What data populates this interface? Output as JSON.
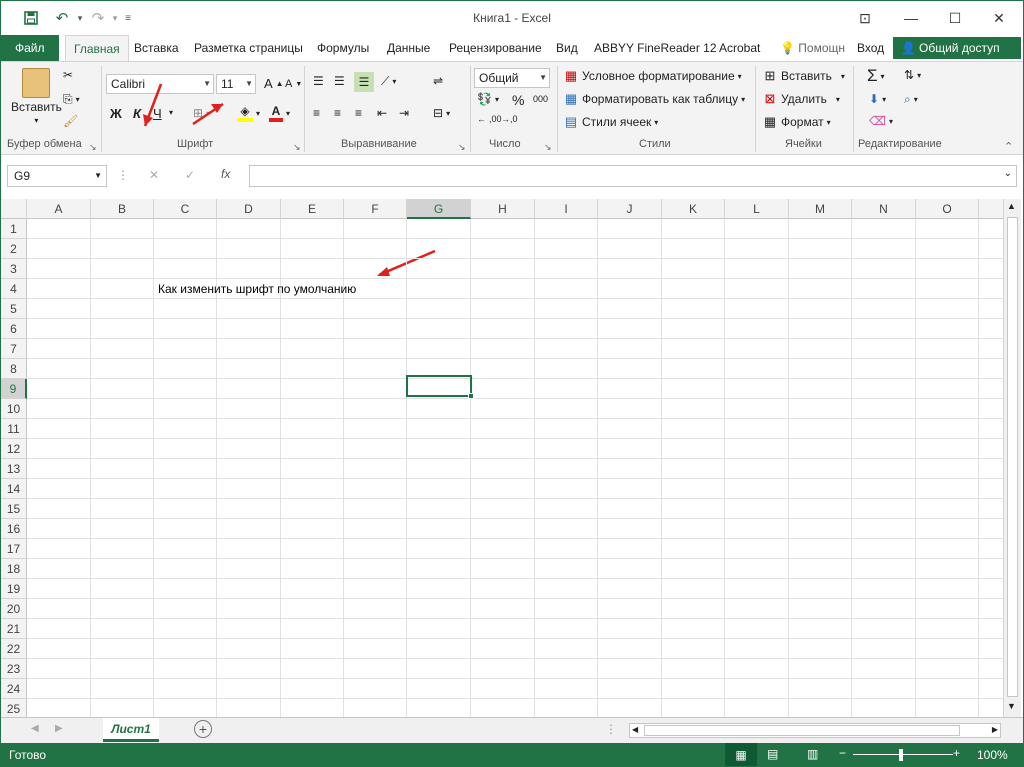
{
  "window": {
    "title": "Книга1 - Excel",
    "accent": "#217346"
  },
  "quick_access": {
    "save_icon": "save-icon",
    "undo_icon": "undo-icon",
    "redo_icon": "redo-icon"
  },
  "tabs": [
    {
      "label": "Файл"
    },
    {
      "label": "Главная"
    },
    {
      "label": "Вставка"
    },
    {
      "label": "Разметка страницы"
    },
    {
      "label": "Формулы"
    },
    {
      "label": "Данные"
    },
    {
      "label": "Рецензирование"
    },
    {
      "label": "Вид"
    },
    {
      "label": "ABBYY FineReader 12"
    },
    {
      "label": "Acrobat"
    }
  ],
  "tell_me": "Помощн",
  "sign_in": "Вход",
  "share": "Общий доступ",
  "ribbon": {
    "clipboard": {
      "paste": "Вставить",
      "label": "Буфер обмена"
    },
    "font": {
      "name": "Calibri",
      "size": "11",
      "bold": "Ж",
      "italic": "К",
      "underline": "Ч",
      "grow": "A",
      "shrink": "A",
      "label": "Шрифт"
    },
    "alignment": {
      "label": "Выравнивание"
    },
    "number": {
      "format": "Общий",
      "percent": "%",
      "thousands": "000",
      "inc_dec": ",00",
      "label": "Число"
    },
    "styles": {
      "conditional": "Условное форматирование",
      "as_table": "Форматировать как таблицу",
      "cell_styles": "Стили ячеек",
      "label": "Стили"
    },
    "cells": {
      "insert": "Вставить",
      "delete": "Удалить",
      "format": "Формат",
      "label": "Ячейки"
    },
    "editing": {
      "label": "Редактирование"
    }
  },
  "formula_bar": {
    "name_box": "G9",
    "fx": "fx",
    "value": ""
  },
  "sheet": {
    "columns": [
      "A",
      "B",
      "C",
      "D",
      "E",
      "F",
      "G",
      "H",
      "I",
      "J",
      "K",
      "L",
      "M",
      "N",
      "O"
    ],
    "rows": [
      "1",
      "2",
      "3",
      "4",
      "5",
      "6",
      "7",
      "8",
      "9",
      "10",
      "11",
      "12",
      "13",
      "14",
      "15",
      "16",
      "17",
      "18",
      "19",
      "20",
      "21",
      "22",
      "23",
      "24",
      "25"
    ],
    "selected_cell": "G9",
    "cells": [
      {
        "ref": "C4",
        "text": "Как изменить шрифт по умолчанию"
      }
    ]
  },
  "sheet_tabs": [
    {
      "label": "Лист1"
    }
  ],
  "status": {
    "ready": "Готово",
    "zoom": "100%"
  },
  "annotation_color": "#e0201b"
}
